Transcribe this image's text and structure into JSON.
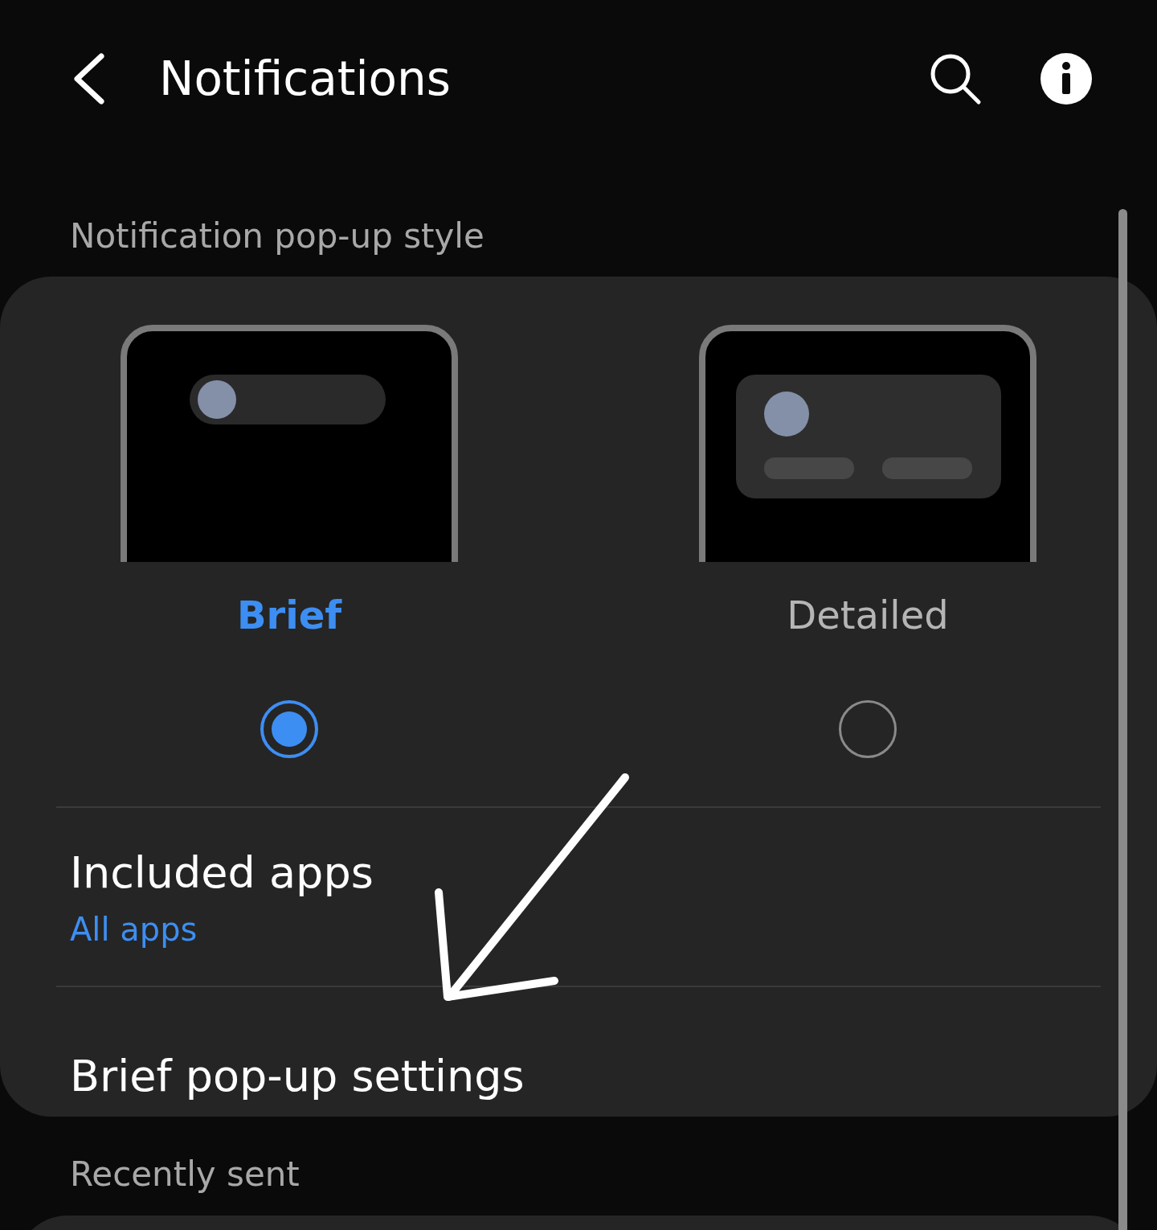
{
  "header": {
    "title": "Notifications"
  },
  "popup_style": {
    "label": "Notification pop-up style",
    "options": [
      {
        "kind": "brief",
        "label": "Brief",
        "selected": true
      },
      {
        "kind": "detailed",
        "label": "Detailed",
        "selected": false
      }
    ],
    "rows": [
      {
        "title": "Included apps",
        "subtitle": "All apps"
      },
      {
        "title": "Brief pop-up settings"
      }
    ]
  },
  "recent": {
    "label": "Recently sent"
  }
}
